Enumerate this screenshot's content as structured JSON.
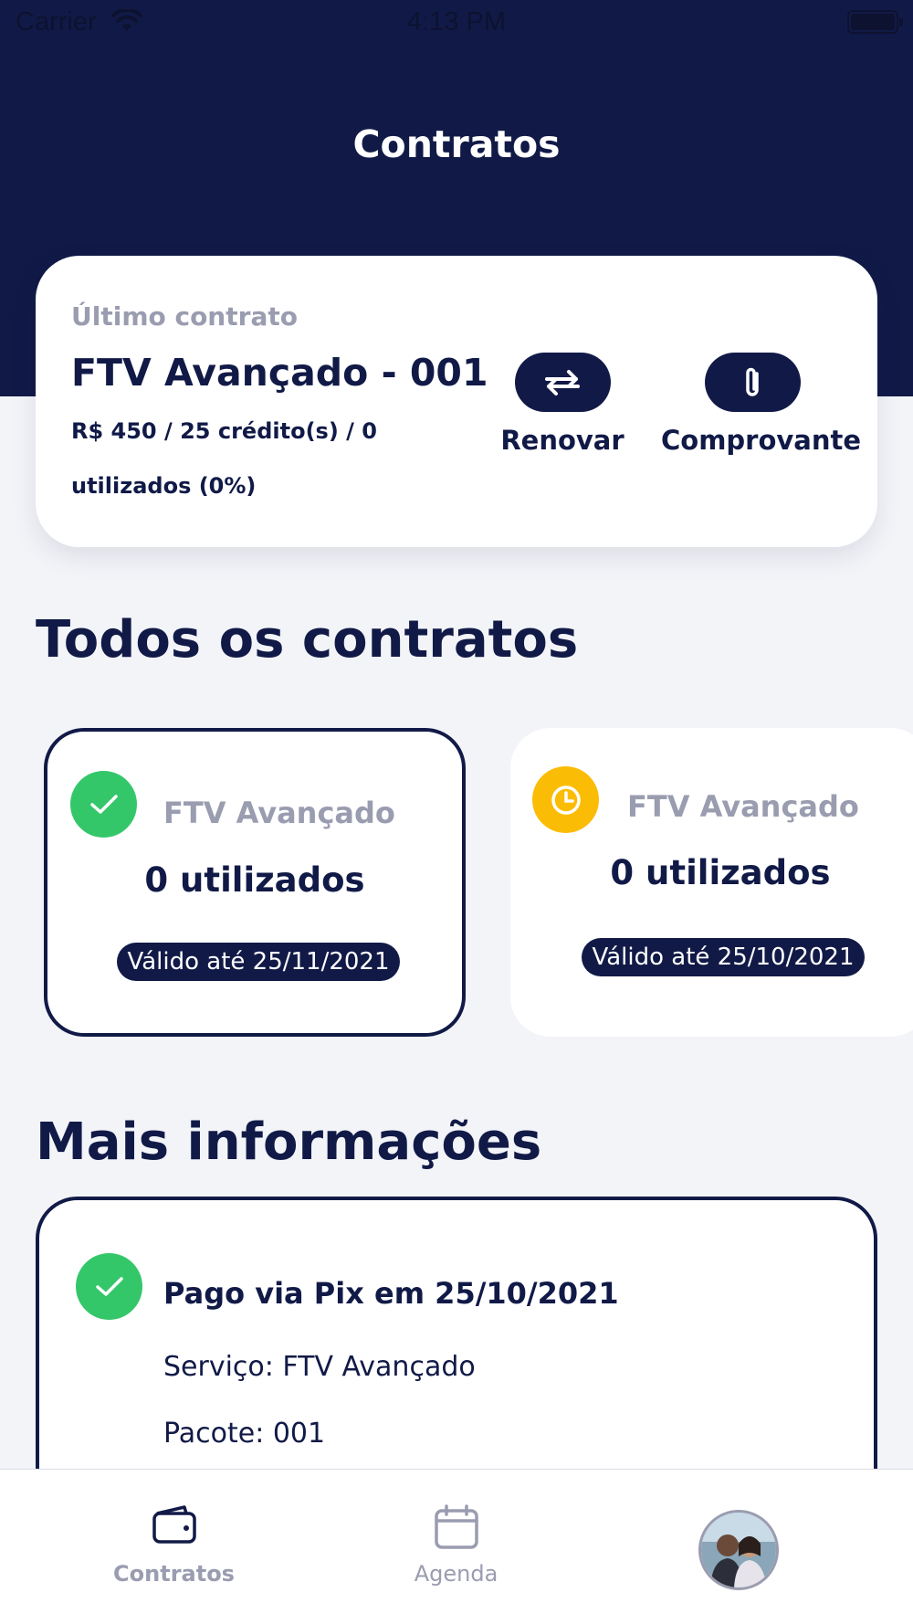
{
  "status_bar": {
    "carrier": "Carrier",
    "time": "4:13 PM"
  },
  "header": {
    "title": "Contratos"
  },
  "last_contract": {
    "label": "Último contrato",
    "name": "FTV Avançado - 001",
    "details": "R$ 450 / 25 crédito(s) / 0 utilizados (0%)",
    "actions": {
      "renew_label": "Renovar",
      "receipt_label": "Comprovante"
    }
  },
  "all_contracts": {
    "title": "Todos os contratos",
    "items": [
      {
        "name": "FTV Avançado",
        "used": "0 utilizados",
        "valid": "Válido até 25/11/2021",
        "status_color": "#34c76a",
        "icon": "check-icon"
      },
      {
        "name": "FTV Avançado",
        "used": "0 utilizados",
        "valid": "Válido até 25/10/2021",
        "status_color": "#fbbc05",
        "icon": "clock-icon"
      }
    ]
  },
  "more_info": {
    "title": "Mais informações",
    "heading": "Pago via Pix em 25/10/2021",
    "service": "Serviço: FTV Avançado",
    "package": "Pacote: 001"
  },
  "tab_bar": {
    "items": [
      {
        "label": "Contratos",
        "icon": "wallet-icon"
      },
      {
        "label": "Agenda",
        "icon": "calendar-icon"
      },
      {
        "label": "",
        "icon": "profile-avatar"
      }
    ]
  },
  "colors": {
    "navy": "#111a47",
    "muted": "#9a9cb0",
    "background": "#f3f4f8",
    "success": "#34c76a",
    "pending": "#fbbc05"
  }
}
